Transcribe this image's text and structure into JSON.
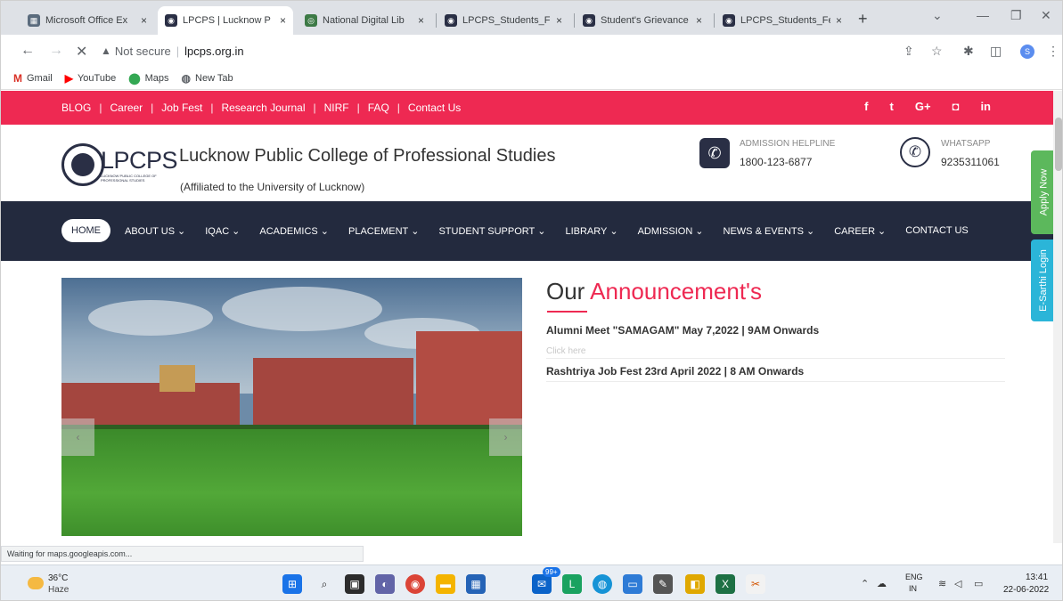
{
  "browser": {
    "tabs": [
      {
        "title": "Microsoft Office Ex",
        "color": "#5a6b7d"
      },
      {
        "title": "LPCPS | Lucknow P",
        "color": "#2a2f45"
      },
      {
        "title": "National Digital Lib",
        "color": "#3d7a46"
      },
      {
        "title": "LPCPS_Students_Fe",
        "color": "#2a2f45"
      },
      {
        "title": "Student's Grievance",
        "color": "#2a2f45"
      },
      {
        "title": "LPCPS_Students_Fe",
        "color": "#2a2f45"
      }
    ],
    "close_glyph": "×",
    "new_tab_glyph": "+",
    "address": {
      "security": "Not secure",
      "url": "lpcps.org.in"
    },
    "bookmarks": [
      {
        "label": "Gmail",
        "icon": "gmail-icon"
      },
      {
        "label": "YouTube",
        "icon": "youtube-icon"
      },
      {
        "label": "Maps",
        "icon": "maps-icon"
      },
      {
        "label": "New Tab",
        "icon": "globe-icon"
      }
    ],
    "profile_initial": "S",
    "status": "Waiting for maps.googleapis.com..."
  },
  "site": {
    "topbar_links": [
      "BLOG",
      "Career",
      "Job Fest",
      "Research Journal",
      "NIRF",
      "FAQ",
      "Contact Us"
    ],
    "social": [
      "f",
      "t",
      "G+",
      "◘",
      "in"
    ],
    "logo": {
      "text": "LPCPS",
      "sub": "LUCKNOW PUBLIC COLLEGE OF PROFESSIONAL STUDIES"
    },
    "college_name": "Lucknow Public College of Professional Studies",
    "affiliation": "(Affiliated to the University of Lucknow)",
    "helpline": {
      "label": "ADMISSION HELPLINE",
      "number": "1800-123-6877"
    },
    "whatsapp": {
      "label": "WHATSAPP",
      "number": "9235311061"
    },
    "menu": [
      "HOME",
      "ABOUT US",
      "IQAC",
      "ACADEMICS",
      "PLACEMENT",
      "STUDENT SUPPORT",
      "LIBRARY",
      "ADMISSION",
      "NEWS & EVENTS",
      "CAREER",
      "CONTACT US"
    ],
    "menu_has_dropdown": [
      false,
      true,
      true,
      true,
      true,
      true,
      true,
      true,
      true,
      true,
      false
    ],
    "dropdown_glyph": "⌄",
    "slider_prev": "‹",
    "slider_next": "›",
    "announcements": {
      "title_main": "Our",
      "title_accent": "Announcement's",
      "items": [
        {
          "text": "Alumni Meet \"SAMAGAM\" May 7,2022 | 9AM Onwards",
          "link": "Click here"
        },
        {
          "text": "Rashtriya Job Fest 23rd April 2022 | 8 AM Onwards",
          "link": ""
        }
      ]
    },
    "side_tabs": [
      {
        "label": "Apply Now",
        "color": "#5cb85c"
      },
      {
        "label": "E-Sarthi Login",
        "color": "#2bb5d8"
      }
    ],
    "accent_color": "#ee2952",
    "nav_color": "#232a3e"
  },
  "taskbar": {
    "weather": {
      "temp": "36°C",
      "desc": "Haze"
    },
    "badge": "99+",
    "lang": {
      "line1": "ENG",
      "line2": "IN"
    },
    "clock": {
      "time": "13:41",
      "date": "22-06-2022"
    }
  }
}
